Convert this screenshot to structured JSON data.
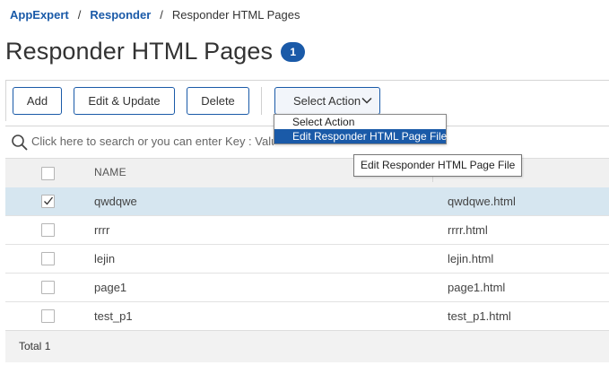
{
  "breadcrumb": {
    "items": [
      "AppExpert",
      "Responder"
    ],
    "current": "Responder HTML Pages",
    "separator": "/"
  },
  "page": {
    "title": "Responder HTML Pages",
    "count": "1"
  },
  "toolbar": {
    "add_label": "Add",
    "edit_label": "Edit & Update",
    "delete_label": "Delete",
    "select_action_label": "Select Action"
  },
  "dropdown": {
    "options": [
      "Select Action",
      "Edit Responder HTML Page File"
    ],
    "highlighted_index": 1
  },
  "tooltip": {
    "text": "Edit Responder HTML Page File"
  },
  "search": {
    "placeholder": "Click here to search or you can enter Key : Value fo"
  },
  "table": {
    "columns": [
      "NAME",
      ""
    ],
    "rows": [
      {
        "name": "qwdqwe",
        "file": "qwdqwe.html",
        "selected": true
      },
      {
        "name": "rrrr",
        "file": "rrrr.html",
        "selected": false
      },
      {
        "name": "lejin",
        "file": "lejin.html",
        "selected": false
      },
      {
        "name": "page1",
        "file": "page1.html",
        "selected": false
      },
      {
        "name": "test_p1",
        "file": "test_p1.html",
        "selected": false
      }
    ]
  },
  "footer": {
    "total_label": "Total",
    "total_value": "1"
  },
  "colors": {
    "accent": "#1a5aa8",
    "selected_row": "#d6e6f0",
    "header_bg": "#f0f0f0"
  }
}
